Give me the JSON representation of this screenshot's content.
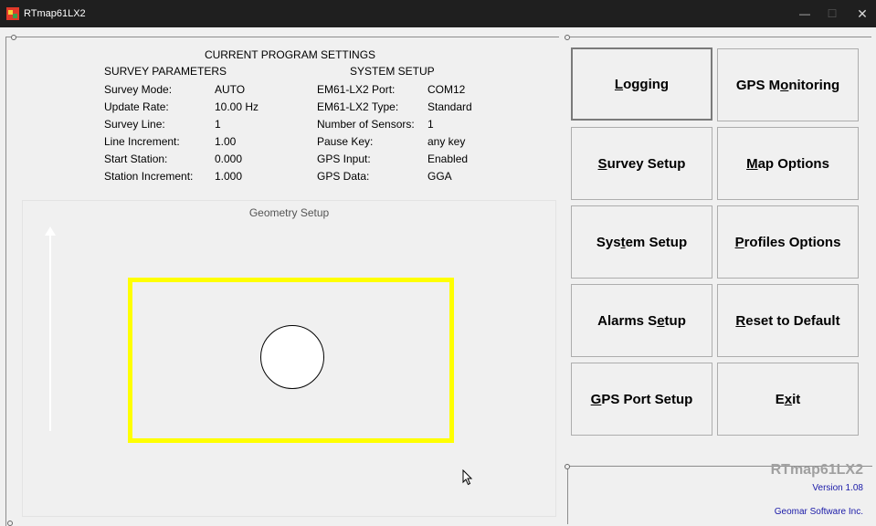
{
  "window": {
    "title": "RTmap61LX2",
    "minimize": "—",
    "maximize": "☐",
    "close": "✕"
  },
  "settings": {
    "title": "CURRENT PROGRAM SETTINGS",
    "survey_header": "SURVEY PARAMETERS",
    "system_header": "SYSTEM SETUP",
    "survey": [
      {
        "label": "Survey Mode:",
        "value": "AUTO"
      },
      {
        "label": "Update Rate:",
        "value": "10.00 Hz"
      },
      {
        "label": "Survey Line:",
        "value": "1"
      },
      {
        "label": "Line Increment:",
        "value": "1.00"
      },
      {
        "label": "Start Station:",
        "value": "0.000"
      },
      {
        "label": "Station Increment:",
        "value": "1.000"
      }
    ],
    "system": [
      {
        "label": "EM61-LX2 Port:",
        "value": "COM12"
      },
      {
        "label": "EM61-LX2 Type:",
        "value": "Standard"
      },
      {
        "label": "Number of Sensors:",
        "value": "1"
      },
      {
        "label": "Pause Key:",
        "value": "any key"
      },
      {
        "label": "GPS Input:",
        "value": "Enabled"
      },
      {
        "label": "GPS Data:",
        "value": "GGA"
      }
    ]
  },
  "geometry": {
    "title": "Geometry Setup",
    "frame_color": "#ffff00"
  },
  "buttons": {
    "logging": {
      "pre": "",
      "key": "L",
      "post": "ogging"
    },
    "gps_monitoring": {
      "pre": "GPS M",
      "key": "o",
      "post": "nitoring"
    },
    "survey_setup": {
      "pre": "",
      "key": "S",
      "post": "urvey Setup"
    },
    "map_options": {
      "pre": "",
      "key": "M",
      "post": "ap Options"
    },
    "system_setup": {
      "pre": "Sys",
      "key": "t",
      "post": "em Setup"
    },
    "profiles_options": {
      "pre": "",
      "key": "P",
      "post": "rofiles Options"
    },
    "alarms_setup": {
      "pre": "Alarms S",
      "key": "e",
      "post": "tup"
    },
    "reset_default": {
      "pre": "",
      "key": "R",
      "post": "eset to Default"
    },
    "gps_port_setup": {
      "pre": "",
      "key": "G",
      "post": "PS Port Setup"
    },
    "exit": {
      "pre": "E",
      "key": "x",
      "post": "it"
    }
  },
  "brand": {
    "name": "RTmap61LX2",
    "version": "Version 1.08",
    "company": "Geomar Software Inc."
  },
  "colors": {
    "titlebar": "#1f1f1f",
    "background": "#f0f0f0",
    "accent_text": "#1a1aa8"
  }
}
